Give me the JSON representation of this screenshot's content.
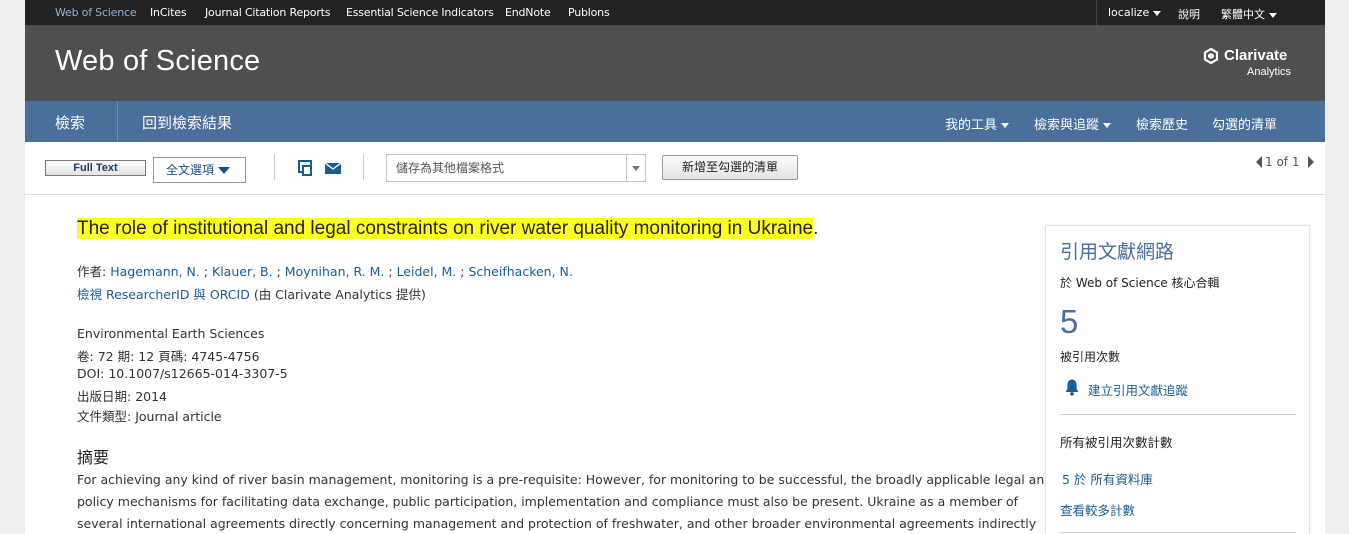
{
  "topbar": {
    "products": [
      "Web of Science",
      "InCites",
      "Journal Citation Reports",
      "Essential Science Indicators",
      "EndNote",
      "Publons"
    ],
    "active_product": "Web of Science",
    "localize": "localize",
    "help": "說明",
    "language": "繁體中文"
  },
  "header": {
    "title": "Web of Science",
    "logo_line1": "Clarivate",
    "logo_line2": "Analytics"
  },
  "nav": {
    "search": "檢索",
    "back_to_results": "回到檢索結果",
    "my_tools": "我的工具",
    "search_tracking": "檢索與追蹤",
    "search_history": "檢索歷史",
    "marked_list": "勾選的清單"
  },
  "toolbar": {
    "full_text": "Full Text",
    "full_text_options": "全文選項",
    "save_format_placeholder": "儲存為其他檔案格式",
    "add_to_marked": "新增至勾選的清單",
    "pager": "1 of 1"
  },
  "record": {
    "title": "The role of institutional and legal constraints on river water quality monitoring in Ukraine",
    "title_end": ".",
    "authors_label": "作者:",
    "authors": [
      "Hagemann, N.",
      "Klauer, B.",
      "Moynihan, R. M.",
      "Leidel, M.",
      "Scheifhacken, N."
    ],
    "researcher_link": "檢視 ResearcherID 與 ORCID",
    "researcher_note": "(由 Clarivate Analytics 提供)",
    "journal": "Environmental Earth Sciences",
    "volume_label": "卷:",
    "volume": "72",
    "issue_label": "期:",
    "issue": "12",
    "pages_label": "頁碼:",
    "pages": "4745-4756",
    "doi_label": "DOI:",
    "doi": "10.1007/s12665-014-3307-5",
    "published_label": "出版日期:",
    "published": "2014",
    "doctype_label": "文件類型:",
    "doctype": "Journal article",
    "abstract_heading": "摘要",
    "abstract_lines": [
      "For achieving any kind of river basin management, monitoring is a pre-requisite: However, for monitoring to be successful, the broadly applicable legal and",
      "policy mechanisms for facilitating data exchange, public participation, implementation and compliance must also be present. Ukraine as a member of",
      "several international agreements directly concerning management and protection of freshwater, and other broader environmental agreements indirectly"
    ]
  },
  "citation_network": {
    "heading": "引用文獻網路",
    "scope": "於 Web of Science 核心合輯",
    "times_cited": "5",
    "times_cited_label": "被引用次數",
    "create_alert": "建立引用文獻追蹤",
    "all_counts_label": "所有被引用次數計數",
    "all_databases": "5 於 所有資料庫",
    "see_more": "查看較多計數"
  },
  "colors": {
    "topbar": "#222222",
    "header": "#4f4f4f",
    "nav": "#4a6f9a",
    "link": "#1a5d94",
    "highlight": "#ffff22"
  }
}
